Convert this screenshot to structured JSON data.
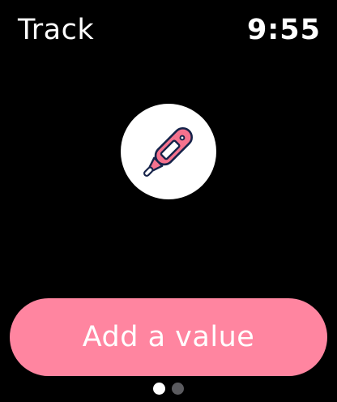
{
  "header": {
    "title": "Track",
    "time": "9:55"
  },
  "main": {
    "icon": "thermometer-icon",
    "button_label": "Add a value"
  },
  "pager": {
    "pages": 2,
    "current": 1
  },
  "colors": {
    "accent": "#ff85a0",
    "background": "#000000",
    "icon_bg": "#ffffff",
    "icon_fill": "#f5728e",
    "icon_stroke": "#16234a",
    "dot_inactive": "#5b5b5f"
  }
}
